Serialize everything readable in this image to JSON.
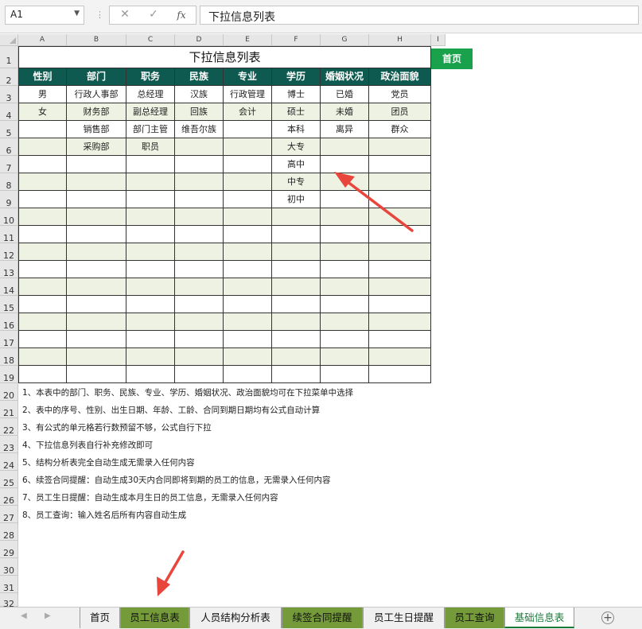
{
  "formula_bar": {
    "name_box": "A1",
    "cancel_icon": "✕",
    "enter_icon": "✓",
    "fx_label": "fx",
    "value": "下拉信息列表"
  },
  "columns": [
    "A",
    "B",
    "C",
    "D",
    "E",
    "F",
    "G",
    "H",
    "I"
  ],
  "rows": [
    "1",
    "2",
    "3",
    "4",
    "5",
    "6",
    "7",
    "8",
    "9",
    "10",
    "11",
    "12",
    "13",
    "14",
    "15",
    "16",
    "17",
    "18",
    "19",
    "20",
    "21",
    "22",
    "23",
    "24",
    "25",
    "26",
    "27",
    "28",
    "29",
    "30",
    "31",
    "32"
  ],
  "sheet": {
    "title": "下拉信息列表",
    "home_button": "首页",
    "headers": [
      "性别",
      "部门",
      "职务",
      "民族",
      "专业",
      "学历",
      "婚姻状况",
      "政治面貌"
    ],
    "data": [
      [
        "男",
        "行政人事部",
        "总经理",
        "汉族",
        "行政管理",
        "博士",
        "已婚",
        "党员"
      ],
      [
        "女",
        "财务部",
        "副总经理",
        "回族",
        "会计",
        "硕士",
        "未婚",
        "团员"
      ],
      [
        "",
        "销售部",
        "部门主管",
        "维吾尔族",
        "",
        "本科",
        "离异",
        "群众"
      ],
      [
        "",
        "采购部",
        "职员",
        "",
        "",
        "大专",
        "",
        ""
      ],
      [
        "",
        "",
        "",
        "",
        "",
        "高中",
        "",
        ""
      ],
      [
        "",
        "",
        "",
        "",
        "",
        "中专",
        "",
        ""
      ],
      [
        "",
        "",
        "",
        "",
        "",
        "初中",
        "",
        ""
      ],
      [
        "",
        "",
        "",
        "",
        "",
        "",
        "",
        ""
      ],
      [
        "",
        "",
        "",
        "",
        "",
        "",
        "",
        ""
      ],
      [
        "",
        "",
        "",
        "",
        "",
        "",
        "",
        ""
      ],
      [
        "",
        "",
        "",
        "",
        "",
        "",
        "",
        ""
      ],
      [
        "",
        "",
        "",
        "",
        "",
        "",
        "",
        ""
      ],
      [
        "",
        "",
        "",
        "",
        "",
        "",
        "",
        ""
      ],
      [
        "",
        "",
        "",
        "",
        "",
        "",
        "",
        ""
      ],
      [
        "",
        "",
        "",
        "",
        "",
        "",
        "",
        ""
      ],
      [
        "",
        "",
        "",
        "",
        "",
        "",
        "",
        ""
      ],
      [
        "",
        "",
        "",
        "",
        "",
        "",
        "",
        ""
      ]
    ],
    "notes": [
      "1、本表中的部门、职务、民族、专业、学历、婚姻状况、政治面貌均可在下拉菜单中选择",
      "2、表中的序号、性别、出生日期、年龄、工龄、合同到期日期均有公式自动计算",
      "3、有公式的单元格若行数预留不够，公式自行下拉",
      "4、下拉信息列表自行补充修改即可",
      "5、结构分析表完全自动生成无需录入任何内容",
      "6、续签合同提醒：自动生成30天内合同即将到期的员工的信息，无需录入任何内容",
      "7、员工生日提醒：自动生成本月生日的员工信息，无需录入任何内容",
      "8、员工查询：输入姓名后所有内容自动生成"
    ]
  },
  "tabs": [
    {
      "label": "首页",
      "style": "plain"
    },
    {
      "label": "员工信息表",
      "style": "green"
    },
    {
      "label": "人员结构分析表",
      "style": "plain"
    },
    {
      "label": "续签合同提醒",
      "style": "green"
    },
    {
      "label": "员工生日提醒",
      "style": "plain"
    },
    {
      "label": "员工查询",
      "style": "green"
    },
    {
      "label": "基础信息表",
      "style": "active"
    }
  ],
  "colors": {
    "header_bg": "#0e5a50",
    "alt_row": "#edf2e2",
    "home_button": "#1aa14c",
    "tab_green": "#759a3a",
    "arrow": "#e8453c"
  }
}
